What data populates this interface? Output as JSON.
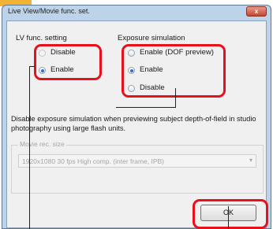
{
  "window": {
    "title": "Live View/Movie func. set.",
    "close_label": "x"
  },
  "lv_func_setting": {
    "label": "LV func. setting",
    "options": [
      {
        "label": "Disable",
        "checked": false
      },
      {
        "label": "Enable",
        "checked": true
      }
    ]
  },
  "exposure_simulation": {
    "label": "Exposure simulation",
    "options": [
      {
        "label": "Enable (DOF preview)",
        "checked": false
      },
      {
        "label": "Enable",
        "checked": true
      },
      {
        "label": "Disable",
        "checked": false
      }
    ]
  },
  "description": "Disable exposure simulation when previewing subject depth-of-field in studio photography using large flash units.",
  "movie_rec_size": {
    "label": "Movie rec. size",
    "value": "1920x1080  30 fps High comp. (inter frame, IPB)",
    "enabled": false
  },
  "ok_label": "OK",
  "colors": {
    "highlight": "#e8101a",
    "title_bar": "#bcd3ea",
    "tab": "#f2b233",
    "radio_selected": "#2d6fd0"
  }
}
